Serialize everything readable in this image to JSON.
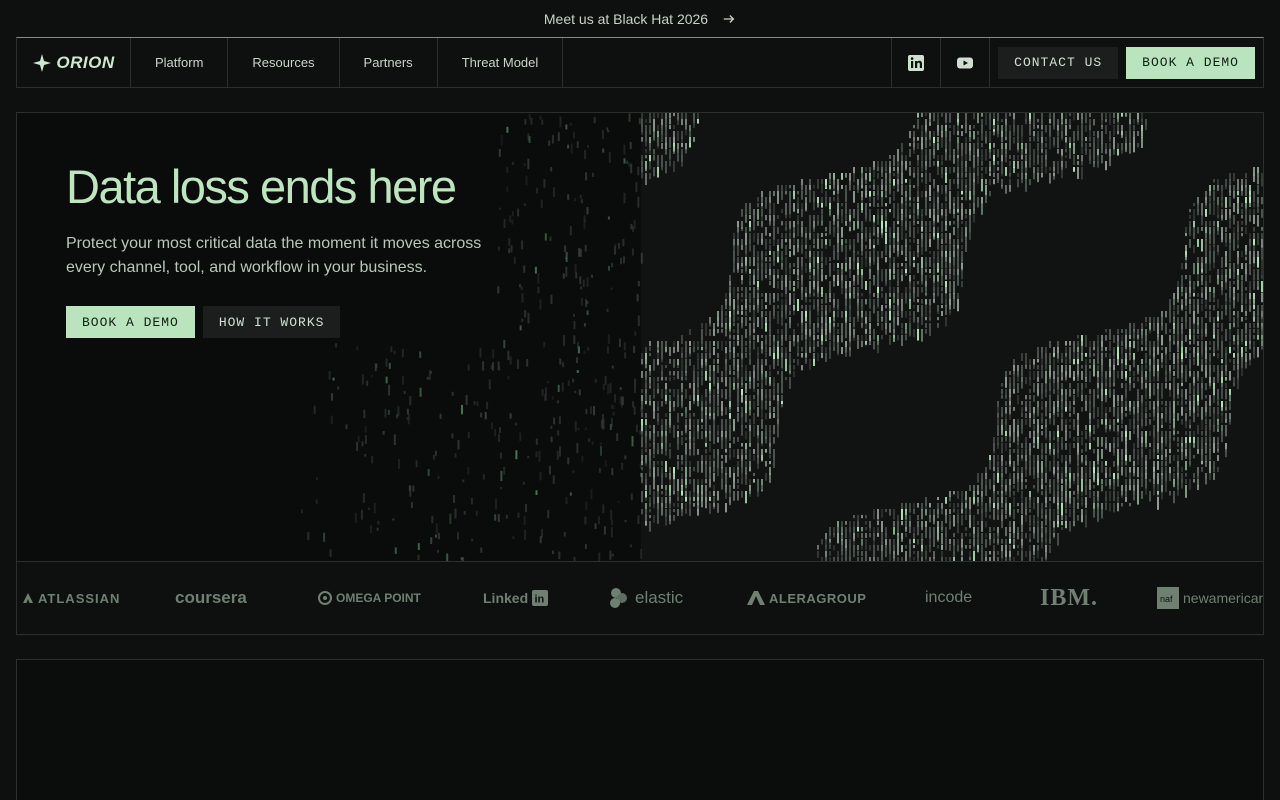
{
  "announcement": {
    "text": "Meet us at Black Hat 2026",
    "icon": "arrow-right-icon"
  },
  "nav": {
    "brand": "ORION",
    "items": [
      {
        "label": "Platform"
      },
      {
        "label": "Resources"
      },
      {
        "label": "Partners"
      },
      {
        "label": "Threat Model"
      }
    ],
    "social": [
      "linkedin-icon",
      "youtube-icon"
    ],
    "contact_label": "CONTACT US",
    "demo_label": "BOOK A DEMO"
  },
  "hero": {
    "title": "Data loss ends here",
    "subtitle": "Protect your most critical data the moment it moves across every channel, tool, and workflow in your business.",
    "primary_label": "BOOK A DEMO",
    "secondary_label": "HOW IT WORKS"
  },
  "customers": {
    "logos": [
      {
        "name": "ATLASSIAN"
      },
      {
        "name": "coursera"
      },
      {
        "name": "OMEGA POINT"
      },
      {
        "name": "Linked"
      },
      {
        "name": "elastic"
      },
      {
        "name": "ALERAGROUP"
      },
      {
        "name": "incode"
      },
      {
        "name": "IBM."
      },
      {
        "name": "newamerican"
      }
    ]
  },
  "colors": {
    "accent": "#b9e4bd",
    "background": "#0e0f0f",
    "border": "#2c302c"
  }
}
